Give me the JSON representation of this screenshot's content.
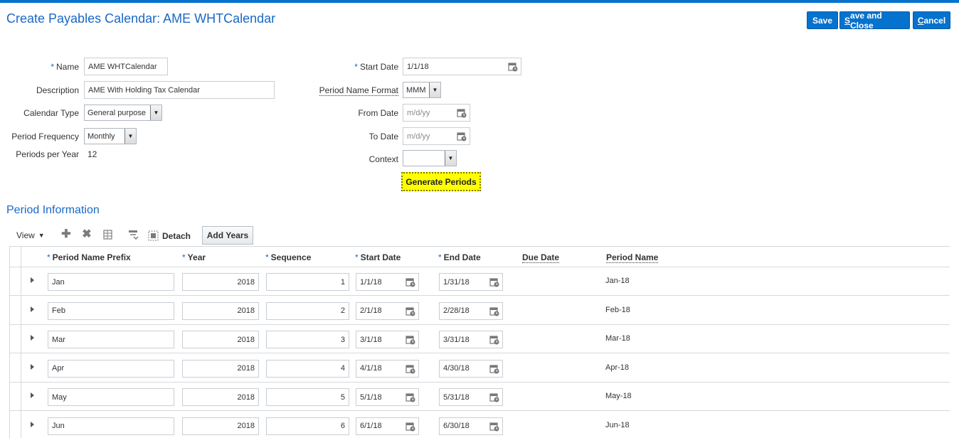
{
  "header": {
    "title": "Create Payables Calendar: AME WHTCalendar",
    "save_label": "Save",
    "save_close_prefix": "S",
    "save_close_rest": "ave and Close",
    "cancel_prefix": "C",
    "cancel_rest": "ancel"
  },
  "form": {
    "required_marker": "*",
    "name_label": "Name",
    "name_value": "AME WHTCalendar",
    "description_label": "Description",
    "description_value": "AME With Holding Tax Calendar",
    "calendar_type_label": "Calendar Type",
    "calendar_type_value": "General purpose",
    "period_frequency_label": "Period Frequency",
    "period_frequency_value": "Monthly",
    "periods_per_year_label": "Periods per Year",
    "periods_per_year_value": "12",
    "start_date_label": "Start Date",
    "start_date_value": "1/1/18",
    "period_name_format_label": "Period Name Format",
    "period_name_format_value": "MMM",
    "from_date_label": "From Date",
    "from_date_placeholder": "m/d/yy",
    "to_date_label": "To Date",
    "to_date_placeholder": "m/d/yy",
    "context_label": "Context",
    "context_value": "",
    "generate_label": "Generate Periods"
  },
  "period_section": {
    "title": "Period Information",
    "view_label": "View",
    "detach_label": "Detach",
    "add_years_label": "Add Years",
    "columns": {
      "prefix": "Period Name Prefix",
      "year": "Year",
      "sequence": "Sequence",
      "start_date": "Start Date",
      "end_date": "End Date",
      "due_date": "Due Date",
      "period_name": "Period Name"
    },
    "rows": [
      {
        "prefix": "Jan",
        "year": "2018",
        "sequence": "1",
        "start": "1/1/18",
        "end": "1/31/18",
        "due": "",
        "name": "Jan-18"
      },
      {
        "prefix": "Feb",
        "year": "2018",
        "sequence": "2",
        "start": "2/1/18",
        "end": "2/28/18",
        "due": "",
        "name": "Feb-18"
      },
      {
        "prefix": "Mar",
        "year": "2018",
        "sequence": "3",
        "start": "3/1/18",
        "end": "3/31/18",
        "due": "",
        "name": "Mar-18"
      },
      {
        "prefix": "Apr",
        "year": "2018",
        "sequence": "4",
        "start": "4/1/18",
        "end": "4/30/18",
        "due": "",
        "name": "Apr-18"
      },
      {
        "prefix": "May",
        "year": "2018",
        "sequence": "5",
        "start": "5/1/18",
        "end": "5/31/18",
        "due": "",
        "name": "May-18"
      },
      {
        "prefix": "Jun",
        "year": "2018",
        "sequence": "6",
        "start": "6/1/18",
        "end": "6/30/18",
        "due": "",
        "name": "Jun-18"
      }
    ]
  },
  "colors": {
    "accent": "#0572ce",
    "title": "#1a68c6",
    "highlight": "#ffff00"
  }
}
